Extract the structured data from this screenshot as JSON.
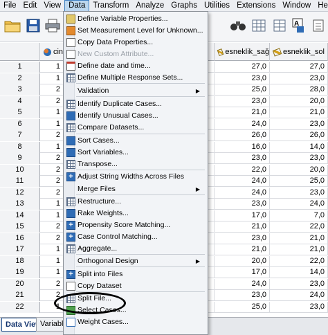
{
  "menubar": [
    "File",
    "Edit",
    "View",
    "Data",
    "Transform",
    "Analyze",
    "Graphs",
    "Utilities",
    "Extensions",
    "Window",
    "Help"
  ],
  "columns": {
    "first_partial": "cin",
    "c1": "esneklik_sağ",
    "c2": "esneklik_sol"
  },
  "rows": [
    {
      "n": "1",
      "a": "1",
      "s": "27,0",
      "l": "27,0"
    },
    {
      "n": "2",
      "a": "1",
      "s": "23,0",
      "l": "23,0"
    },
    {
      "n": "3",
      "a": "2",
      "s": "25,0",
      "l": "28,0"
    },
    {
      "n": "4",
      "a": "2",
      "s": "23,0",
      "l": "20,0"
    },
    {
      "n": "5",
      "a": "1",
      "s": "21,0",
      "l": "21,0"
    },
    {
      "n": "6",
      "a": "1",
      "s": "24,0",
      "l": "23,0"
    },
    {
      "n": "7",
      "a": "2",
      "s": "26,0",
      "l": "26,0"
    },
    {
      "n": "8",
      "a": "1",
      "s": "16,0",
      "l": "14,0"
    },
    {
      "n": "9",
      "a": "2",
      "s": "23,0",
      "l": "23,0"
    },
    {
      "n": "10",
      "a": "2",
      "s": "22,0",
      "l": "20,0"
    },
    {
      "n": "11",
      "a": "2",
      "s": "24,0",
      "l": "25,0"
    },
    {
      "n": "12",
      "a": "2",
      "s": "24,0",
      "l": "23,0"
    },
    {
      "n": "13",
      "a": "1",
      "s": "23,0",
      "l": "24,0"
    },
    {
      "n": "14",
      "a": "1",
      "s": "17,0",
      "l": "7,0"
    },
    {
      "n": "15",
      "a": "2",
      "s": "21,0",
      "l": "22,0"
    },
    {
      "n": "16",
      "a": "2",
      "s": "23,0",
      "l": "21,0"
    },
    {
      "n": "17",
      "a": "1",
      "s": "21,0",
      "l": "21,0"
    },
    {
      "n": "18",
      "a": "1",
      "s": "20,0",
      "l": "22,0"
    },
    {
      "n": "19",
      "a": "1",
      "s": "17,0",
      "l": "14,0"
    },
    {
      "n": "20",
      "a": "2",
      "s": "24,0",
      "l": "23,0"
    },
    {
      "n": "21",
      "a": "2",
      "s": "23,0",
      "l": "24,0"
    },
    {
      "n": "22",
      "a": "1",
      "s": "25,0",
      "l": "23,0"
    }
  ],
  "tabs": {
    "data_view": "Data View",
    "variable_view": "Variable V"
  },
  "data_menu": [
    {
      "label": "Define Variable Properties...",
      "icon": "ruler-icon"
    },
    {
      "label": "Set Measurement Level for Unknown...",
      "icon": "scale-icon"
    },
    {
      "label": "Copy Data Properties...",
      "icon": "copy-icon"
    },
    {
      "label": "New Custom Attribute...",
      "icon": "attribute-icon",
      "disabled": true
    },
    {
      "label": "Define date and time...",
      "icon": "calendar-icon"
    },
    {
      "label": "Define Multiple Response Sets...",
      "icon": "grid-icon"
    },
    {
      "label": "Validation",
      "submenu": true
    },
    {
      "label": "Identify Duplicate Cases...",
      "icon": "duplicate-icon"
    },
    {
      "label": "Identify Unusual Cases...",
      "icon": "unusual-icon"
    },
    {
      "label": "Compare Datasets...",
      "icon": "compare-icon"
    },
    {
      "label": "Sort Cases...",
      "icon": "sort-cases-icon"
    },
    {
      "label": "Sort Variables...",
      "icon": "sort-variables-icon"
    },
    {
      "label": "Transpose...",
      "icon": "transpose-icon"
    },
    {
      "label": "Adjust String Widths Across Files",
      "icon": "plus-icon"
    },
    {
      "label": "Merge Files",
      "submenu": true
    },
    {
      "label": "Restructure...",
      "icon": "restructure-icon"
    },
    {
      "label": "Rake Weights...",
      "icon": "rake-icon"
    },
    {
      "label": "Propensity Score Matching...",
      "icon": "plus-icon"
    },
    {
      "label": "Case Control Matching...",
      "icon": "plus-icon"
    },
    {
      "label": "Aggregate...",
      "icon": "aggregate-icon"
    },
    {
      "label": "Orthogonal Design",
      "submenu": true
    },
    {
      "label": "Split into Files",
      "icon": "plus-icon"
    },
    {
      "label": "Copy Dataset",
      "icon": "copy-dataset-icon"
    },
    {
      "label": "Split File...",
      "icon": "split-file-icon"
    },
    {
      "label": "Select Cases...",
      "icon": "select-cases-icon"
    },
    {
      "label": "Weight Cases...",
      "icon": "weight-icon"
    }
  ],
  "colors": {
    "menu_highlight": "#bcd7ee",
    "menu_border": "#3d7fc0",
    "tab_active_border": "#1f4e8c"
  }
}
